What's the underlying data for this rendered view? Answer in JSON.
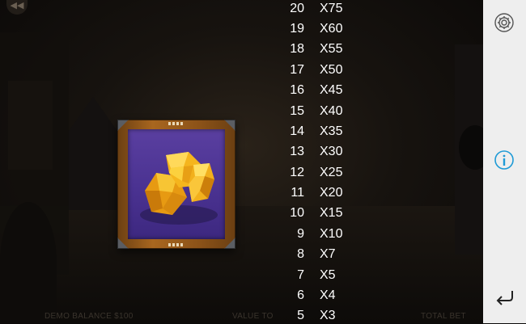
{
  "game": {
    "symbol_name": "gold-nugget",
    "paytable": [
      {
        "count": "20",
        "multiplier": "X75"
      },
      {
        "count": "19",
        "multiplier": "X60"
      },
      {
        "count": "18",
        "multiplier": "X55"
      },
      {
        "count": "17",
        "multiplier": "X50"
      },
      {
        "count": "16",
        "multiplier": "X45"
      },
      {
        "count": "15",
        "multiplier": "X40"
      },
      {
        "count": "14",
        "multiplier": "X35"
      },
      {
        "count": "13",
        "multiplier": "X30"
      },
      {
        "count": "12",
        "multiplier": "X25"
      },
      {
        "count": "11",
        "multiplier": "X20"
      },
      {
        "count": "10",
        "multiplier": "X15"
      },
      {
        "count": "9",
        "multiplier": "X10"
      },
      {
        "count": "8",
        "multiplier": "X7"
      },
      {
        "count": "7",
        "multiplier": "X5"
      },
      {
        "count": "6",
        "multiplier": "X4"
      },
      {
        "count": "5",
        "multiplier": "X3"
      }
    ]
  },
  "bottom_bar": {
    "balance_label": "DEMO BALANCE  $100",
    "value_label": "VALUE TO",
    "total_bet_label": "TOTAL BET"
  },
  "sidebar": {
    "settings_icon": "gear-icon",
    "info_icon": "info-icon",
    "exit_icon": "return-arrow-icon"
  },
  "colors": {
    "frame_wood": "#a8661f",
    "symbol_bg": "#4a3291",
    "nugget_gold": "#f3b21e",
    "info_accent": "#1e9ad6",
    "sidebar_bg": "#eeeeee"
  }
}
